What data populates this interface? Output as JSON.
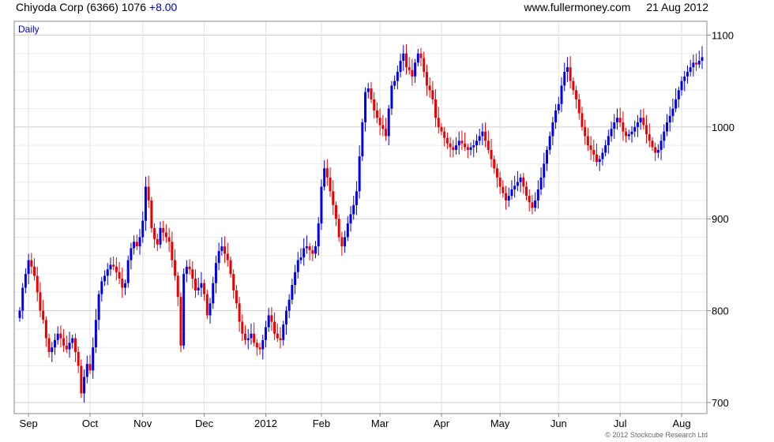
{
  "header": {
    "instrument": "Chiyoda Corp (6366)",
    "last": "1076",
    "change": "+8.00",
    "source": "www.fullermoney.com",
    "date": "21 Aug 2012"
  },
  "footer": {
    "copyright": "© 2012 Stockcube Research Ltd"
  },
  "colors": {
    "up": "#0000ee",
    "down": "#ee0000",
    "grid": "#d8d8d8",
    "frame": "#888888",
    "period_label": "#0000cc"
  },
  "chart_data": {
    "type": "candlestick",
    "period_label": "Daily",
    "ylim": [
      688,
      1115
    ],
    "y_ticks": [
      700,
      800,
      900,
      1000,
      1100
    ],
    "y_axis_side": "right",
    "grid": true,
    "x_ticks": [
      {
        "label": "Sep",
        "index": 3
      },
      {
        "label": "Oct",
        "index": 24
      },
      {
        "label": "Nov",
        "index": 42
      },
      {
        "label": "Dec",
        "index": 63
      },
      {
        "label": "2012",
        "index": 84
      },
      {
        "label": "Feb",
        "index": 103
      },
      {
        "label": "Mar",
        "index": 123
      },
      {
        "label": "Apr",
        "index": 144
      },
      {
        "label": "May",
        "index": 164
      },
      {
        "label": "Jun",
        "index": 184
      },
      {
        "label": "Jul",
        "index": 205
      },
      {
        "label": "Aug",
        "index": 226
      }
    ],
    "closes": [
      800,
      825,
      840,
      855,
      848,
      838,
      820,
      800,
      790,
      770,
      755,
      760,
      768,
      775,
      770,
      762,
      758,
      765,
      770,
      755,
      740,
      710,
      728,
      742,
      735,
      760,
      790,
      818,
      832,
      838,
      845,
      850,
      848,
      842,
      835,
      825,
      830,
      855,
      868,
      875,
      870,
      880,
      898,
      935,
      920,
      890,
      878,
      872,
      890,
      885,
      880,
      875,
      855,
      838,
      815,
      762,
      840,
      848,
      845,
      835,
      822,
      825,
      830,
      818,
      795,
      808,
      830,
      852,
      865,
      870,
      862,
      855,
      840,
      822,
      808,
      788,
      775,
      768,
      770,
      775,
      765,
      760,
      758,
      768,
      782,
      795,
      788,
      775,
      770,
      768,
      785,
      800,
      812,
      828,
      842,
      855,
      858,
      868,
      870,
      866,
      862,
      870,
      895,
      935,
      955,
      945,
      930,
      915,
      900,
      880,
      870,
      880,
      895,
      905,
      915,
      930,
      968,
      1005,
      1038,
      1042,
      1030,
      1018,
      1010,
      1002,
      998,
      990,
      1020,
      1045,
      1050,
      1060,
      1072,
      1080,
      1065,
      1062,
      1055,
      1070,
      1080,
      1075,
      1060,
      1045,
      1040,
      1030,
      1010,
      1000,
      995,
      988,
      982,
      978,
      975,
      980,
      985,
      982,
      978,
      975,
      978,
      980,
      985,
      990,
      995,
      985,
      975,
      965,
      955,
      945,
      935,
      928,
      920,
      925,
      932,
      936,
      940,
      945,
      935,
      925,
      918,
      912,
      920,
      932,
      945,
      960,
      975,
      990,
      1005,
      1018,
      1025,
      1045,
      1060,
      1065,
      1050,
      1040,
      1030,
      1015,
      1000,
      990,
      980,
      975,
      970,
      962,
      965,
      972,
      980,
      990,
      998,
      1005,
      1010,
      1005,
      995,
      990,
      992,
      995,
      1000,
      1005,
      1010,
      1002,
      992,
      985,
      978,
      972,
      975,
      985,
      995,
      1005,
      1012,
      1020,
      1030,
      1040,
      1050,
      1055,
      1060,
      1065,
      1070,
      1068,
      1072,
      1076
    ]
  }
}
